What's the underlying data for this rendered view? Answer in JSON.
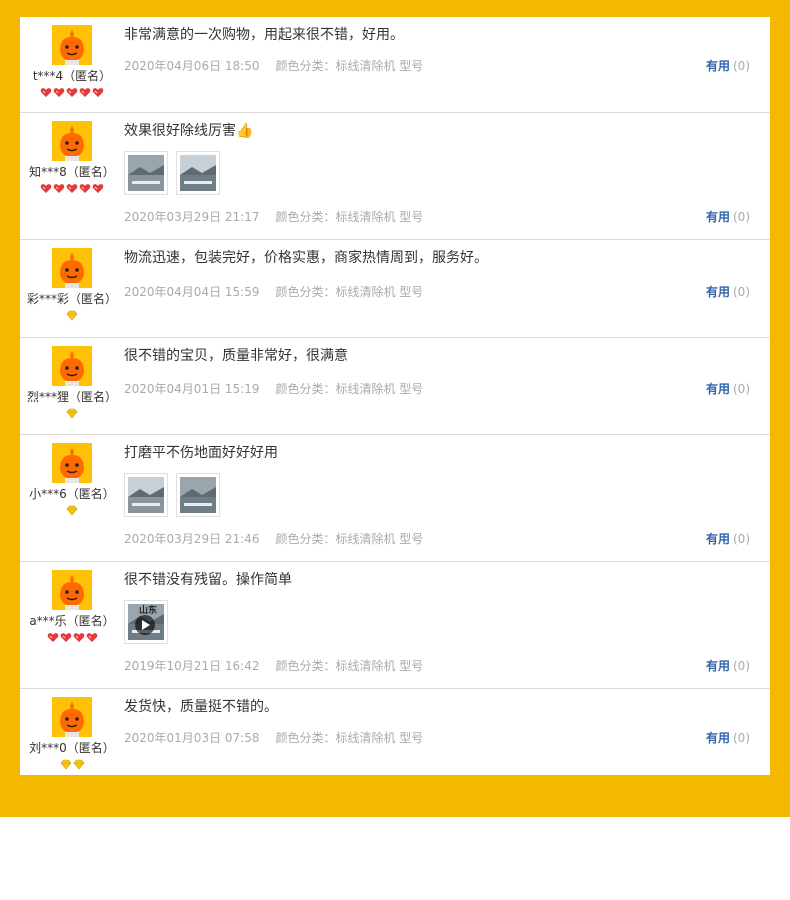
{
  "useful_label": "有用",
  "colors": {
    "frame": "#F5B800",
    "link": "#3366aa",
    "meta": "#aaaaaa"
  },
  "reviews": [
    {
      "user": "t***4（匿名）",
      "badge": "red-heart",
      "badge_count": 5,
      "text": "非常满意的一次购物，用起来很不错，好用。",
      "date": "2020年04月06日 18:50",
      "category": "颜色分类：标线清除机 型号",
      "useful_count": "(0)",
      "photos": []
    },
    {
      "user": "知***8（匿名）",
      "badge": "red-heart",
      "badge_count": 5,
      "text": "效果很好除线厉害👍",
      "date": "2020年03月29日 21:17",
      "category": "颜色分类：标线清除机 型号",
      "useful_count": "(0)",
      "photos": [
        "photo",
        "photo"
      ]
    },
    {
      "user": "彩***彩（匿名）",
      "badge": "yellow-diamond",
      "badge_count": 1,
      "text": "物流迅速，包装完好，价格实惠，商家热情周到，服务好。",
      "date": "2020年04月04日 15:59",
      "category": "颜色分类：标线清除机 型号",
      "useful_count": "(0)",
      "photos": []
    },
    {
      "user": "烈***狸（匿名）",
      "badge": "yellow-diamond",
      "badge_count": 1,
      "text": "很不错的宝贝，质量非常好，很满意",
      "date": "2020年04月01日 15:19",
      "category": "颜色分类：标线清除机 型号",
      "useful_count": "(0)",
      "photos": []
    },
    {
      "user": "小***6（匿名）",
      "badge": "yellow-diamond",
      "badge_count": 1,
      "text": "打磨平不伤地面好好好用",
      "date": "2020年03月29日 21:46",
      "category": "颜色分类：标线清除机 型号",
      "useful_count": "(0)",
      "photos": [
        "photo",
        "photo"
      ]
    },
    {
      "user": "a***乐（匿名）",
      "badge": "red-heart",
      "badge_count": 4,
      "text": "很不错没有残留。操作简单",
      "date": "2019年10月21日 16:42",
      "category": "颜色分类：标线清除机 型号",
      "useful_count": "(0)",
      "photos": [
        "video"
      ],
      "video_tag": "山东"
    },
    {
      "user": "刘***0（匿名）",
      "badge": "yellow-diamond",
      "badge_count": 2,
      "text": "发货快，质量挺不错的。",
      "date": "2020年01月03日 07:58",
      "category": "颜色分类：标线清除机 型号",
      "useful_count": "(0)",
      "photos": []
    }
  ]
}
